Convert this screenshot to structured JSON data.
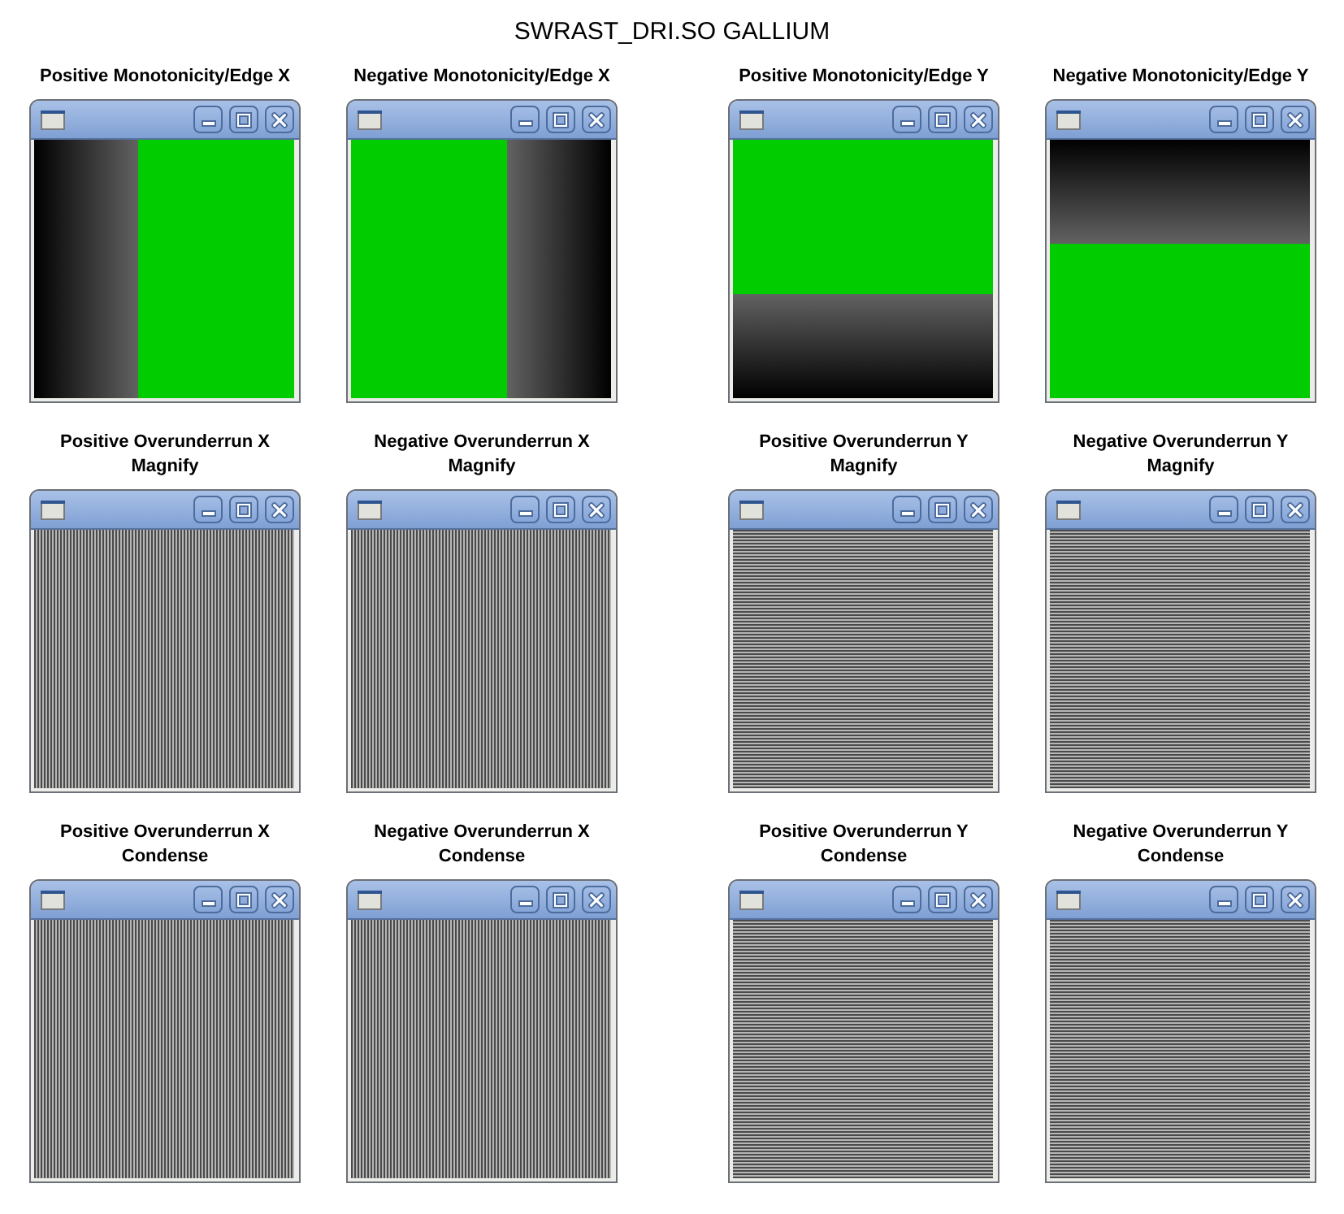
{
  "title": "SWRAST_DRI.SO GALLIUM",
  "rows": [
    {
      "panels": [
        {
          "caption": "Positive Monotonicity/Edge X",
          "kind": "edge",
          "y_axis": false,
          "positive": true
        },
        {
          "caption": "Negative Monotonicity/Edge X",
          "kind": "edge",
          "y_axis": false,
          "positive": false
        },
        {
          "caption": "Positive Monotonicity/Edge Y",
          "kind": "edge",
          "y_axis": true,
          "positive": true
        },
        {
          "caption": "Negative Monotonicity/Edge Y",
          "kind": "edge",
          "y_axis": true,
          "positive": false
        }
      ]
    },
    {
      "panels": [
        {
          "caption": "Positive Overunderrun X\nMagnify",
          "kind": "stripes",
          "y_axis": false
        },
        {
          "caption": "Negative Overunderrun X\nMagnify",
          "kind": "stripes",
          "y_axis": false
        },
        {
          "caption": "Positive Overunderrun Y\nMagnify",
          "kind": "stripes",
          "y_axis": true
        },
        {
          "caption": "Negative Overunderrun Y\nMagnify",
          "kind": "stripes",
          "y_axis": true
        }
      ]
    },
    {
      "panels": [
        {
          "caption": "Positive Overunderrun X\nCondense",
          "kind": "stripes",
          "y_axis": false
        },
        {
          "caption": "Negative Overunderrun X\nCondense",
          "kind": "stripes",
          "y_axis": false
        },
        {
          "caption": "Positive Overunderrun Y\nCondense",
          "kind": "stripes",
          "y_axis": true
        },
        {
          "caption": "Negative Overunderrun Y\nCondense",
          "kind": "stripes",
          "y_axis": true
        }
      ]
    }
  ]
}
